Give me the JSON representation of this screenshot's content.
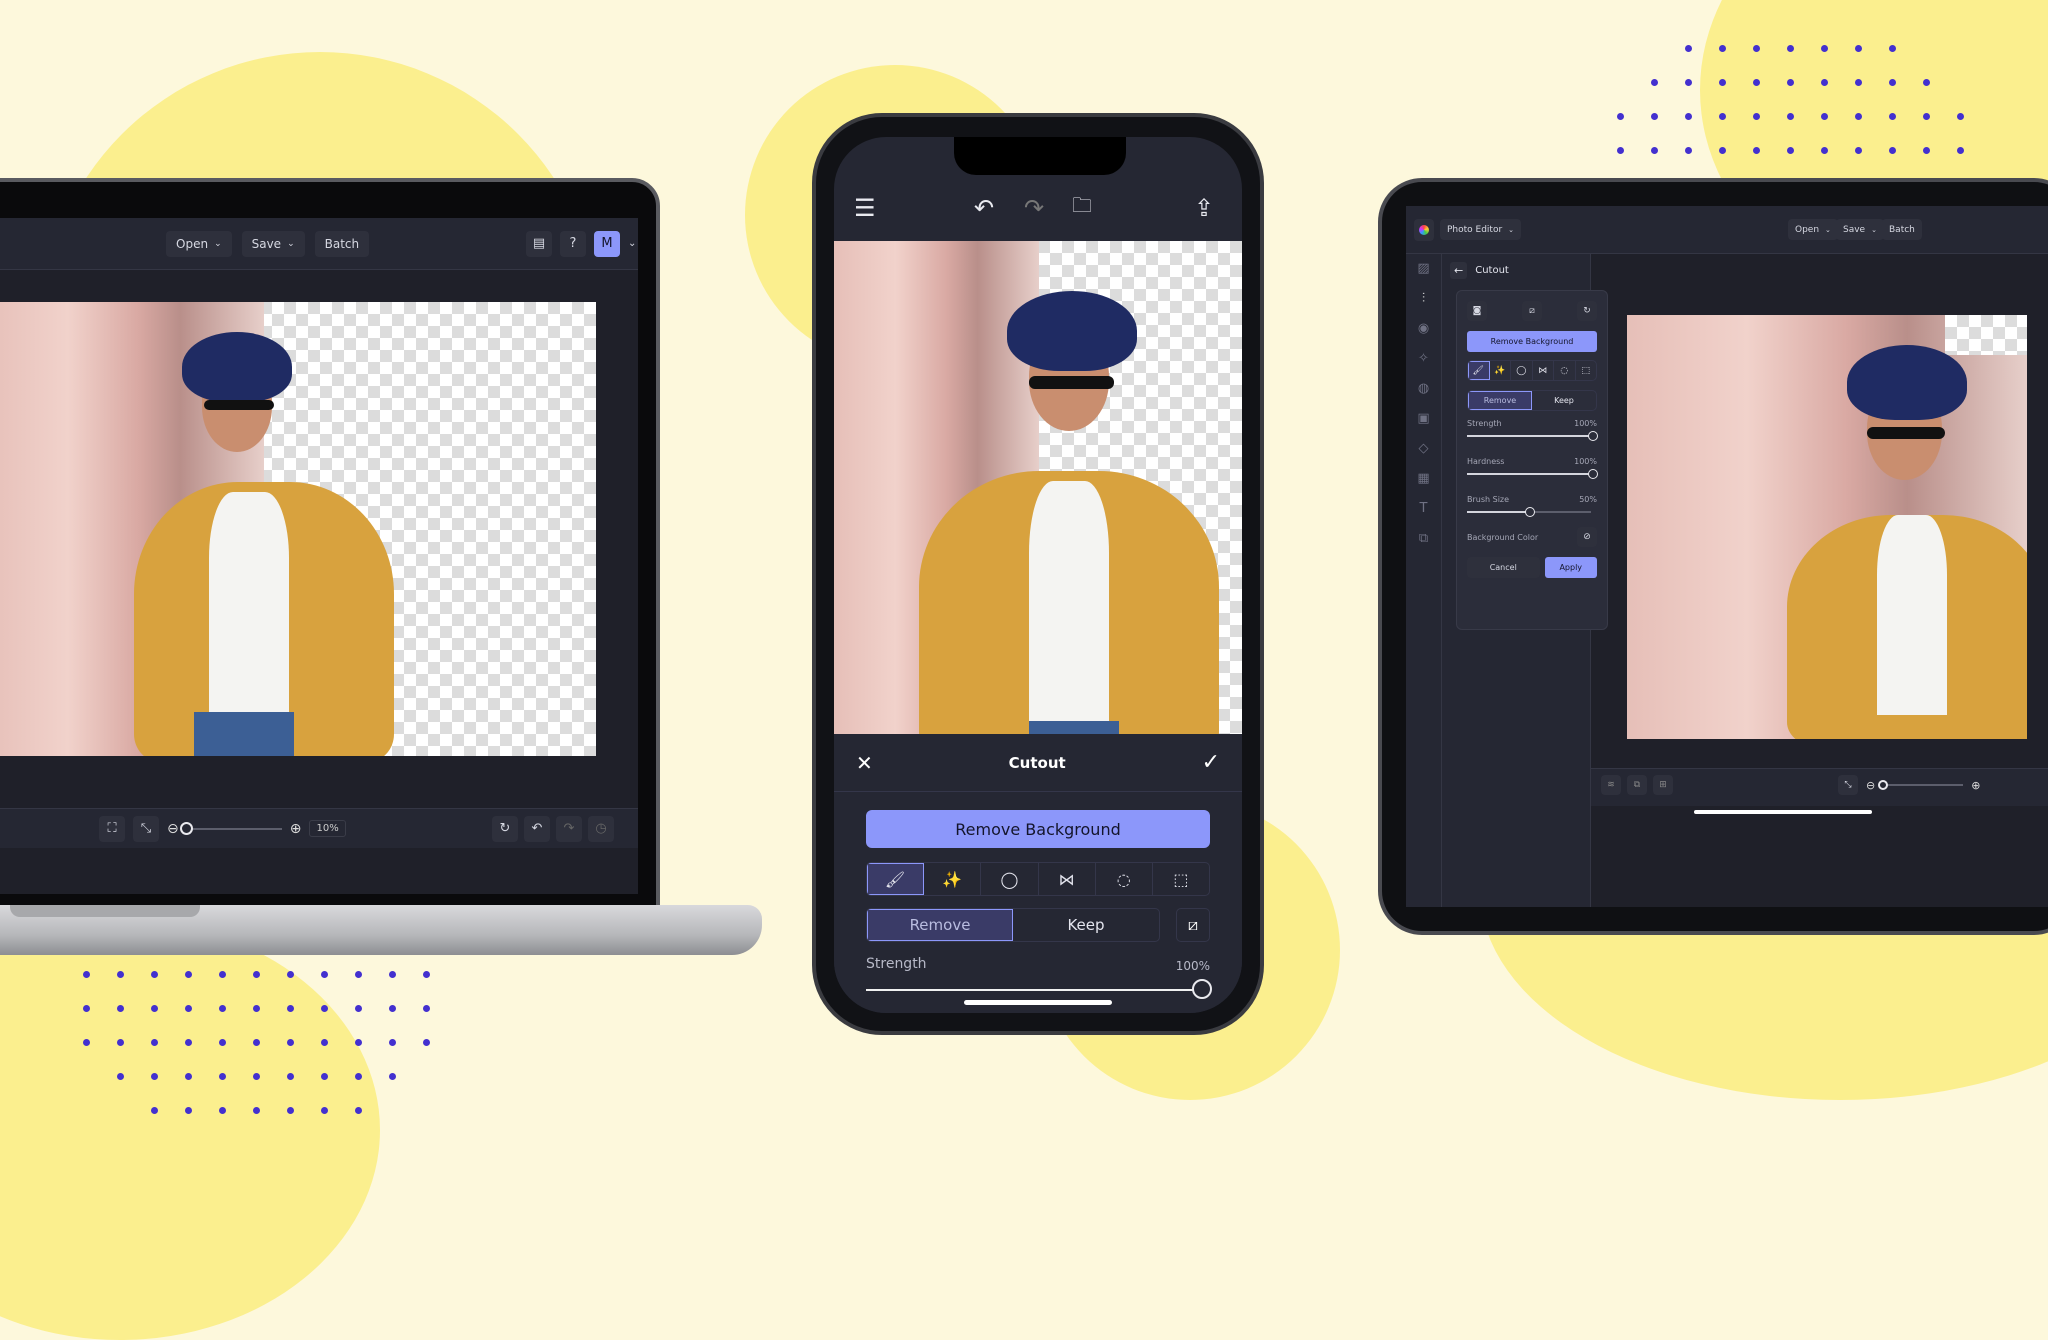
{
  "laptop": {
    "toolbar": {
      "open_label": "Open",
      "save_label": "Save",
      "batch_label": "Batch",
      "avatar_initial": "M",
      "icons": [
        "feedback-icon",
        "help-icon",
        "chevron-down-icon"
      ]
    },
    "bottom_bar": {
      "zoom_value": "10%",
      "zoom_fraction": 0.0,
      "icons": [
        "fit-screen-icon",
        "collapse-icon",
        "zoom-out-icon",
        "zoom-in-icon",
        "reset-icon",
        "undo-icon",
        "redo-icon",
        "history-icon"
      ]
    }
  },
  "phone": {
    "top_icons": [
      "menu-icon",
      "undo-icon",
      "redo-icon",
      "open-folder-icon",
      "share-icon"
    ],
    "panel": {
      "title": "Cutout",
      "remove_background_label": "Remove Background",
      "tools": [
        "brush",
        "magic-wand",
        "lasso",
        "polygon-lasso",
        "ellipse-select",
        "rect-select"
      ],
      "active_tool": "brush",
      "mode_remove": "Remove",
      "mode_keep": "Keep",
      "active_mode": "Remove",
      "strength_label": "Strength",
      "strength_value": "100%",
      "strength_fraction": 1.0
    }
  },
  "tablet": {
    "app_name": "Photo Editor",
    "open_label": "Open",
    "save_label": "Save",
    "batch_label": "Batch",
    "panel_title": "Cutout",
    "remove_background_label": "Remove Background",
    "mode_remove": "Remove",
    "mode_keep": "Keep",
    "sliders": [
      {
        "label": "Strength",
        "value": "100%",
        "fraction": 1.0
      },
      {
        "label": "Hardness",
        "value": "100%",
        "fraction": 1.0
      },
      {
        "label": "Brush Size",
        "value": "50%",
        "fraction": 0.5
      }
    ],
    "background_color_label": "Background Color",
    "cancel_label": "Cancel",
    "apply_label": "Apply",
    "zoom_fraction": 0.0
  },
  "colors": {
    "accent": "#8c97fa",
    "dots": "#4330cf",
    "background": "#fdf8dc",
    "blob": "#fbef8e"
  }
}
